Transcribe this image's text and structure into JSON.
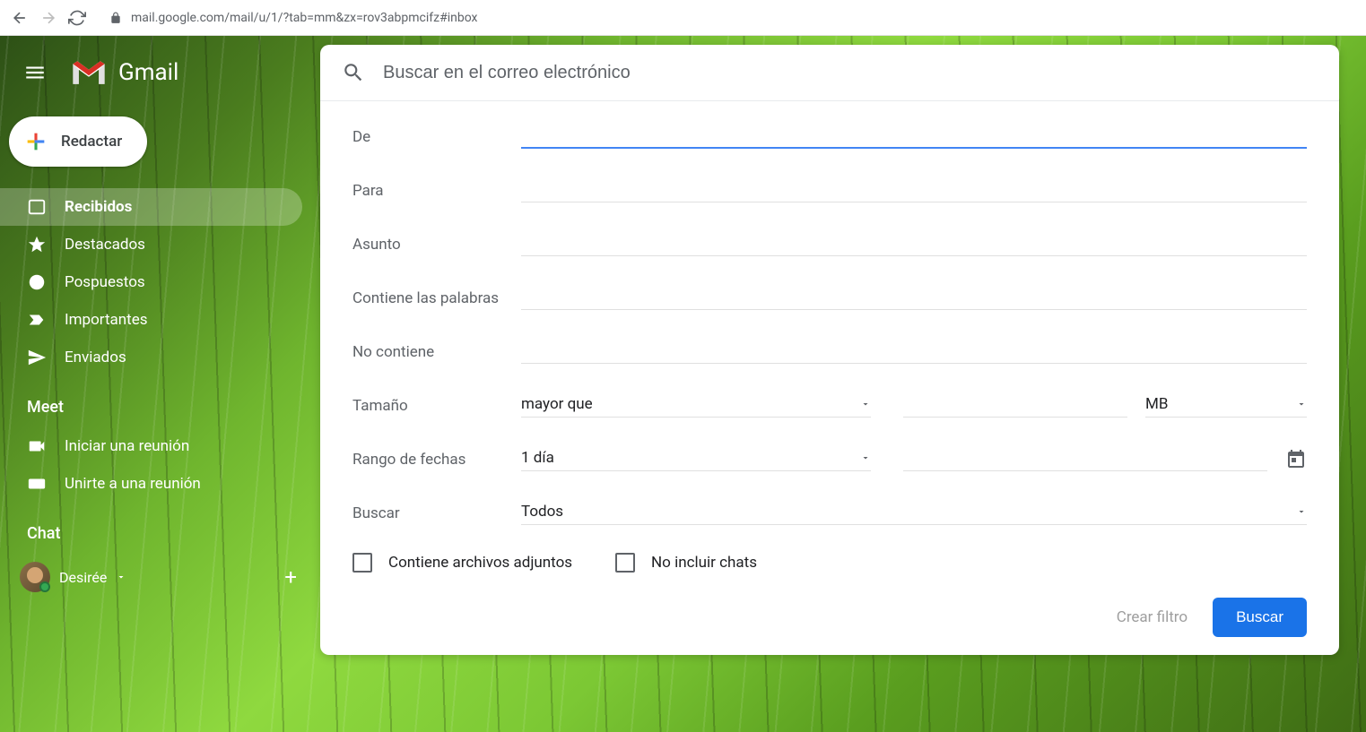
{
  "browser": {
    "url": "mail.google.com/mail/u/1/?tab=mm&zx=rov3abpmcifz#inbox"
  },
  "header": {
    "app_name": "Gmail"
  },
  "compose": {
    "label": "Redactar"
  },
  "sidebar": {
    "items": [
      {
        "label": "Recibidos"
      },
      {
        "label": "Destacados"
      },
      {
        "label": "Pospuestos"
      },
      {
        "label": "Importantes"
      },
      {
        "label": "Enviados"
      }
    ],
    "meet_header": "Meet",
    "meet_items": [
      {
        "label": "Iniciar una reunión"
      },
      {
        "label": "Unirte a una reunión"
      }
    ],
    "chat_header": "Chat",
    "chat_user": "Desirée"
  },
  "search": {
    "placeholder": "Buscar en el correo electrónico",
    "labels": {
      "from": "De",
      "to": "Para",
      "subject": "Asunto",
      "has_words": "Contiene las palabras",
      "not_has": "No contiene",
      "size": "Tamaño",
      "date_range": "Rango de fechas",
      "search_in": "Buscar"
    },
    "size_op": "mayor que",
    "size_unit": "MB",
    "date_value": "1 día",
    "search_in_value": "Todos",
    "checkboxes": {
      "has_attachment": "Contiene archivos adjuntos",
      "no_chats": "No incluir chats"
    },
    "actions": {
      "create_filter": "Crear filtro",
      "search": "Buscar"
    }
  }
}
